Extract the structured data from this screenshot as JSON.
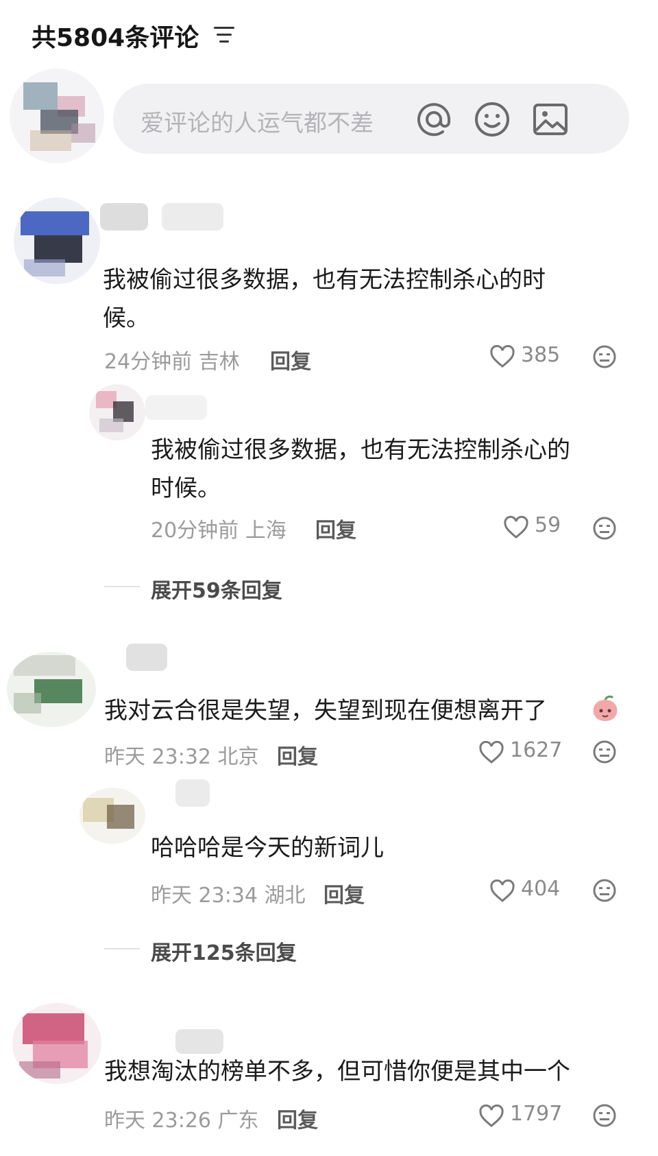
{
  "header": {
    "title": "共5804条评论",
    "filter_icon": "filter-icon"
  },
  "input": {
    "placeholder": "爱评论的人运气都不差",
    "icons": [
      "at-icon",
      "emoji-icon",
      "image-icon"
    ]
  },
  "comments": [
    {
      "text_line1": "我被偷过很多数据，也有无法控制杀心的时",
      "text_line2": "候。",
      "time": "24分钟前",
      "location": "吉林",
      "reply": "回复",
      "likes": "385"
    },
    {
      "text_line1": "我对云合很是失望，失望到现在便想离开了",
      "time": "昨天 23:32",
      "location": "北京",
      "reply": "回复",
      "likes": "1627"
    },
    {
      "text_line1": "我想淘汰的榜单不多，但可惜你便是其中一个",
      "time": "昨天 23:26",
      "location": "广东",
      "reply": "回复",
      "likes": "1797"
    }
  ],
  "replies": [
    {
      "text_line1": "我被偷过很多数据，也有无法控制杀心的",
      "text_line2": "时候。",
      "time": "20分钟前",
      "location": "上海",
      "reply": "回复",
      "likes": "59"
    },
    {
      "text_line1": "哈哈哈是今天的新词儿",
      "time": "昨天 23:34",
      "location": "湖北",
      "reply": "回复",
      "likes": "404"
    }
  ],
  "expand": [
    {
      "label": "展开59条回复"
    },
    {
      "label": "展开125条回复"
    }
  ],
  "colors": {
    "background": "#ffffff",
    "text": "#1b1b1b",
    "meta": "#9b9b9b",
    "input_bg": "#f1f1f3"
  }
}
